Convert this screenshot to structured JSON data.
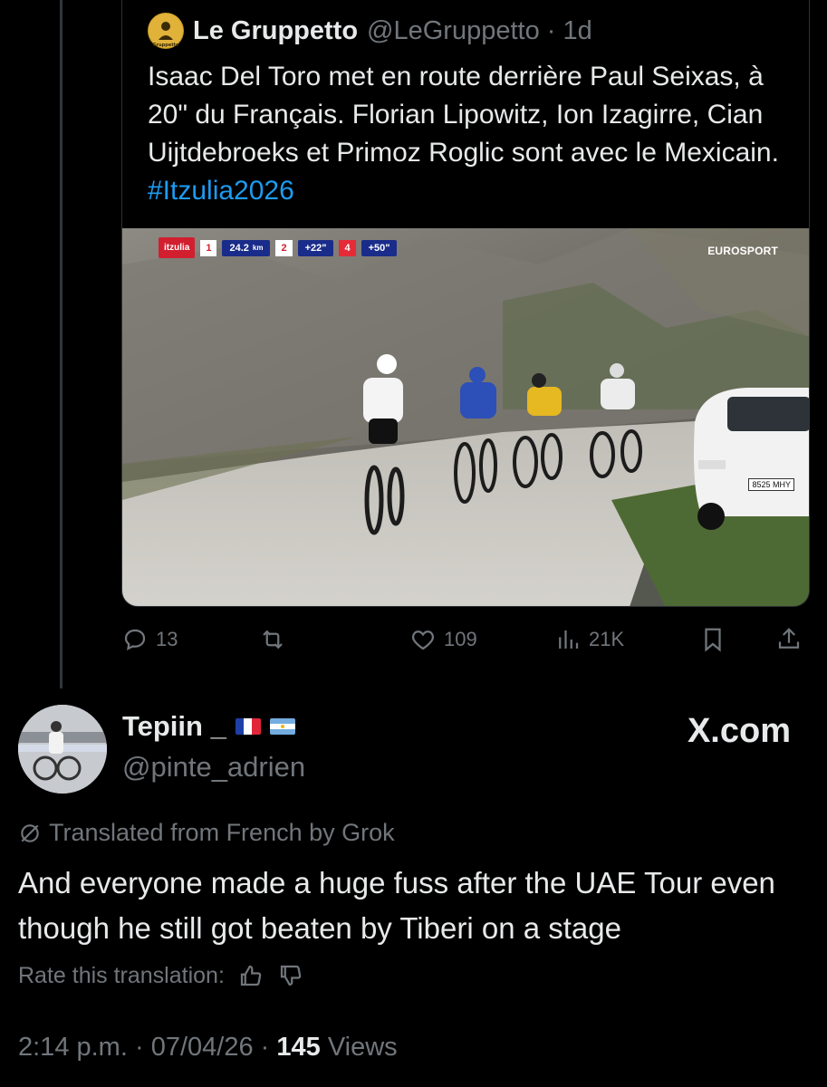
{
  "quoted_tweet": {
    "author_name": "Le Gruppetto",
    "author_handle": "@LeGruppetto",
    "time_ago": "1d",
    "text": "Isaac Del Toro met en route derrière Paul Seixas, à 20\" du Français. Florian Lipowitz, Ion Izagirre, Cian Uijtdebroeks et Primoz Roglic sont avec le Mexicain. ",
    "hashtag": "#Itzulia2026",
    "video_overlay": {
      "logo": "itzulia",
      "pos1": "1",
      "distance": "24.2",
      "distance_unit": "km",
      "pos2": "2",
      "gap2": "+22\"",
      "pos4": "4",
      "gap4": "+50\"",
      "broadcaster": "EUROSPORT",
      "plate": "8525 MHY"
    },
    "actions": {
      "replies": "13",
      "retweets": "",
      "likes": "109",
      "views": "21K"
    }
  },
  "reply": {
    "author_name": "Tepiin _",
    "author_handle": "@pinte_adrien",
    "source": "X.com",
    "translated_label": "Translated from French by Grok",
    "text": "And everyone made a huge fuss after the UAE Tour even though he still got beaten by Tiberi on a stage",
    "rate_label": "Rate this translation:",
    "time": "2:14 p.m.",
    "date": "07/04/26",
    "views_count": "145",
    "views_label": "Views"
  },
  "colors": {
    "background": "#000000",
    "text": "#e7e9ea",
    "muted": "#71767b",
    "link": "#1d9bf0",
    "border": "#2f3336"
  }
}
